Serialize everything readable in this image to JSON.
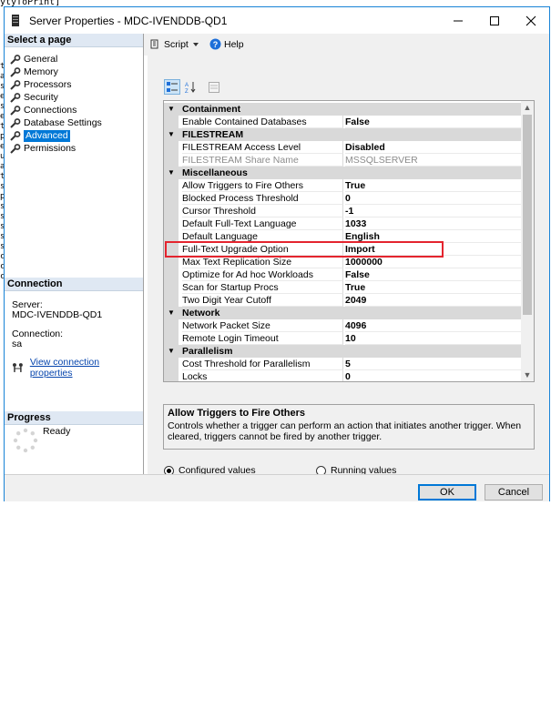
{
  "background": {
    "code_snippet": "ytyToPrint]",
    "left_edge_chars": [
      "ti",
      "a",
      "s",
      "e",
      "s",
      "e",
      "t",
      "p",
      "e",
      "u",
      "a",
      "t",
      "s",
      "p",
      "s",
      "s",
      "s",
      "s",
      "s",
      "c",
      "c",
      "c"
    ]
  },
  "window": {
    "title": "Server Properties - MDC-IVENDDB-QD1",
    "minimize_glyph": "—",
    "maximize_glyph": "☐",
    "close_glyph": "✕"
  },
  "left_pane": {
    "select_page_header": "Select a page",
    "pages": [
      {
        "label": "General"
      },
      {
        "label": "Memory"
      },
      {
        "label": "Processors"
      },
      {
        "label": "Security"
      },
      {
        "label": "Connections"
      },
      {
        "label": "Database Settings"
      },
      {
        "label": "Advanced",
        "selected": true
      },
      {
        "label": "Permissions"
      }
    ],
    "connection_header": "Connection",
    "server_label": "Server:",
    "server_value": "MDC-IVENDDB-QD1",
    "connection_label": "Connection:",
    "connection_value": "sa",
    "view_connection_link": "View connection properties",
    "progress_header": "Progress",
    "progress_status": "Ready"
  },
  "toolbar": {
    "script_label": "Script",
    "help_label": "Help"
  },
  "property_grid": {
    "sections": [
      {
        "name": "Containment",
        "items": [
          {
            "name": "Enable Contained Databases",
            "value": "False"
          }
        ]
      },
      {
        "name": "FILESTREAM",
        "items": [
          {
            "name": "FILESTREAM Access Level",
            "value": "Disabled"
          },
          {
            "name": "FILESTREAM Share Name",
            "value": "MSSQLSERVER",
            "disabled": true
          }
        ]
      },
      {
        "name": "Miscellaneous",
        "items": [
          {
            "name": "Allow Triggers to Fire Others",
            "value": "True"
          },
          {
            "name": "Blocked Process Threshold",
            "value": "0"
          },
          {
            "name": "Cursor Threshold",
            "value": "-1"
          },
          {
            "name": "Default Full-Text Language",
            "value": "1033"
          },
          {
            "name": "Default Language",
            "value": "English"
          },
          {
            "name": "Full-Text Upgrade Option",
            "value": "Import"
          },
          {
            "name": "Max Text Replication Size",
            "value": "1000000"
          },
          {
            "name": "Optimize for Ad hoc Workloads",
            "value": "False"
          },
          {
            "name": "Scan for Startup Procs",
            "value": "True"
          },
          {
            "name": "Two Digit Year Cutoff",
            "value": "2049"
          }
        ]
      },
      {
        "name": "Network",
        "items": [
          {
            "name": "Network Packet Size",
            "value": "4096"
          },
          {
            "name": "Remote Login Timeout",
            "value": "10"
          }
        ]
      },
      {
        "name": "Parallelism",
        "items": [
          {
            "name": "Cost Threshold for Parallelism",
            "value": "5"
          },
          {
            "name": "Locks",
            "value": "0"
          }
        ]
      }
    ],
    "highlight_color": "#e4242e"
  },
  "description": {
    "title": "Allow Triggers to Fire Others",
    "text": "Controls whether a trigger can perform an action that initiates another trigger. When cleared, triggers cannot be fired by another trigger."
  },
  "options": {
    "configured_label": "Configured values",
    "running_label": "Running values",
    "selected": "configured"
  },
  "buttons": {
    "ok_label": "OK",
    "cancel_label": "Cancel"
  },
  "colors": {
    "accent": "#0078d7",
    "window_border": "#1883d7",
    "section_header": "#dfe8f3",
    "category_row": "#d9d9d9"
  }
}
